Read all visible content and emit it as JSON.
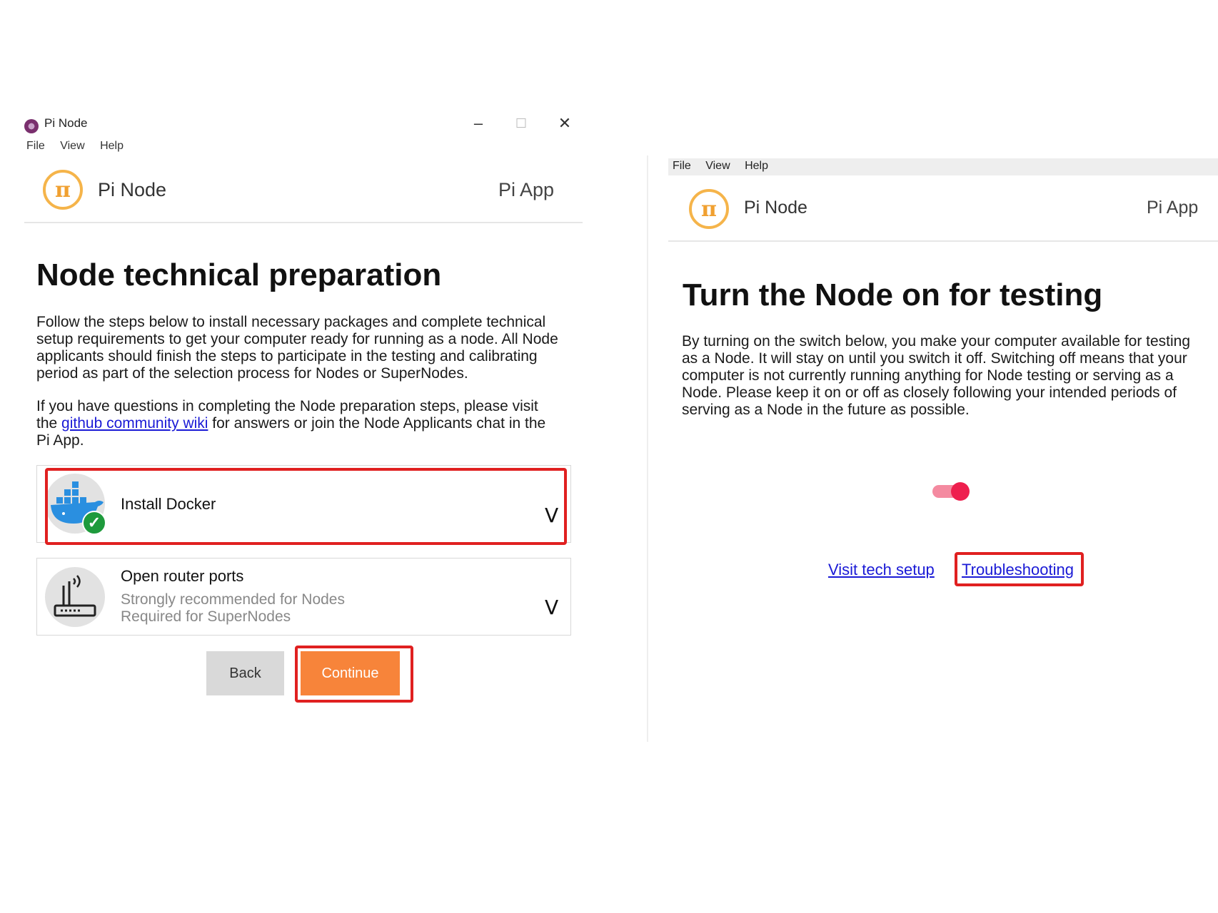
{
  "left_window": {
    "title": "Pi Node",
    "controls": {
      "minimize": "–",
      "maximize": "☐",
      "close": "✕"
    },
    "menu": [
      "File",
      "View",
      "Help"
    ],
    "header": {
      "logo": "π",
      "title": "Pi Node",
      "right_link": "Pi App"
    },
    "heading": "Node technical preparation",
    "intro": [
      "Follow the steps below to install necessary packages and complete technical",
      "setup requirements to get your computer ready for running as a node. All Node",
      "applicants should finish the steps to participate in the testing and calibrating",
      "period as part of the selection process for Nodes or SuperNodes."
    ],
    "questions": {
      "line1": "If you have questions in completing the Node preparation steps, please visit",
      "before_link": "the ",
      "link": "github community wiki",
      "after_link": " for answers or join the Node Applicants chat in the",
      "line3": "Pi App."
    },
    "steps": [
      {
        "title": "Install Docker",
        "icon": "docker-whale-icon",
        "status_icon": "check-icon",
        "status_mark": "✓",
        "chevron": "V"
      },
      {
        "title": "Open router ports",
        "icon": "router-icon",
        "subtitle1": "Strongly recommended for Nodes",
        "subtitle2": "Required for SuperNodes",
        "chevron": "V"
      }
    ],
    "buttons": {
      "back": "Back",
      "continue": "Continue"
    }
  },
  "right_window": {
    "menu": [
      "File",
      "View",
      "Help"
    ],
    "header": {
      "logo": "π",
      "title": "Pi Node",
      "right_link": "Pi App"
    },
    "heading": "Turn the Node on for testing",
    "body": [
      "By turning on the switch below, you make your computer available for testing",
      "as a Node. It will stay on until you switch it off. Switching off means that your",
      "computer is not currently running anything for Node testing or serving as a",
      "Node. Please keep it on or off as closely following your intended periods of",
      "serving as a Node in the future as possible."
    ],
    "toggle_on": true,
    "links": {
      "tech_setup": "Visit tech setup",
      "troubleshooting": "Troubleshooting"
    }
  },
  "colors": {
    "accent_orange": "#f7843a",
    "logo_orange": "#f5b44a",
    "highlight_red": "#e02020",
    "toggle_pink": "#ee1f4e",
    "link_blue": "#1a1ad6"
  }
}
